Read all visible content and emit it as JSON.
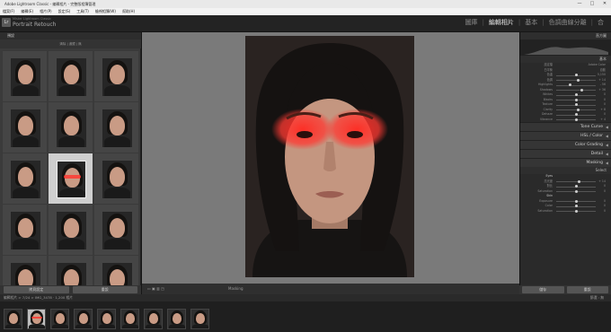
{
  "window": {
    "title": "Adobe Lightroom Classic - 編輯相片 - 完整版相簿管理",
    "controls": [
      "—",
      "□",
      "✕"
    ]
  },
  "menubar": {
    "items": [
      "檔案(F)",
      "編輯(E)",
      "相片(P)",
      "設定(S)",
      "工具(T)",
      "檢視相簿(W)",
      "幫助(H)"
    ]
  },
  "identity": {
    "logo": "Lr",
    "subtitle": "Mister Lightroom Classic",
    "name": "Portrait Retouch"
  },
  "modules": {
    "items": [
      "圖庫",
      "編輯相片",
      "基本",
      "色調曲線分離",
      "合"
    ],
    "active_index": 1
  },
  "left_panel": {
    "title": "預設",
    "sub": "清除 | 濾鏡 | 無"
  },
  "left_buttons": {
    "copy": "拷貝設定",
    "reset": "重設"
  },
  "toolbar": {
    "mask_label": "Masking"
  },
  "right_panel": {
    "header": "直方圖",
    "basic_title": "基本",
    "profile_label": "設定檔",
    "profile_value": "Adobe Color",
    "wb_label": "白平衡",
    "wb_value": "自動",
    "sliders": [
      {
        "label": "色溫",
        "value": "5,150",
        "pos": 0.5
      },
      {
        "label": "色調",
        "value": "+ 14",
        "pos": 0.55
      },
      {
        "label": "Highlights",
        "value": "- 56",
        "pos": 0.35
      },
      {
        "label": "Shadows",
        "value": "+ 36",
        "pos": 0.65
      },
      {
        "label": "Whites",
        "value": "0",
        "pos": 0.5
      },
      {
        "label": "Blacks",
        "value": "0",
        "pos": 0.5
      },
      {
        "label": "Texture",
        "value": "0",
        "pos": 0.5
      },
      {
        "label": "Clarity",
        "value": "+ 8",
        "pos": 0.55
      },
      {
        "label": "Dehaze",
        "value": "0",
        "pos": 0.5
      },
      {
        "label": "Vibrance",
        "value": "+ 4",
        "pos": 0.52
      }
    ],
    "sections": [
      "Tone Curve",
      "HSL / Color",
      "Color Grading",
      "Detail",
      "Masking"
    ],
    "mask_name": "Select",
    "eyes_label": "Eyes",
    "eyes_sliders": [
      {
        "label": "亮光度",
        "value": "+ 14",
        "pos": 0.58
      },
      {
        "label": "對比",
        "value": "0",
        "pos": 0.5
      },
      {
        "label": "Saturation",
        "value": "0",
        "pos": 0.5
      }
    ],
    "skin_label": "Skin",
    "skin_sliders": [
      {
        "label": "Exposure",
        "value": "0",
        "pos": 0.5
      },
      {
        "label": "Color",
        "value": "0",
        "pos": 0.5
      },
      {
        "label": "Saturation",
        "value": "0",
        "pos": 0.5
      }
    ],
    "save_label": "儲存",
    "reset_label": "重設"
  },
  "filmstrip": {
    "path": "編輯相片 > 7/24 > IMG_3478 · 1,200 相片",
    "filter_label": "篩選 : 無",
    "selected": 1,
    "count": 9
  }
}
